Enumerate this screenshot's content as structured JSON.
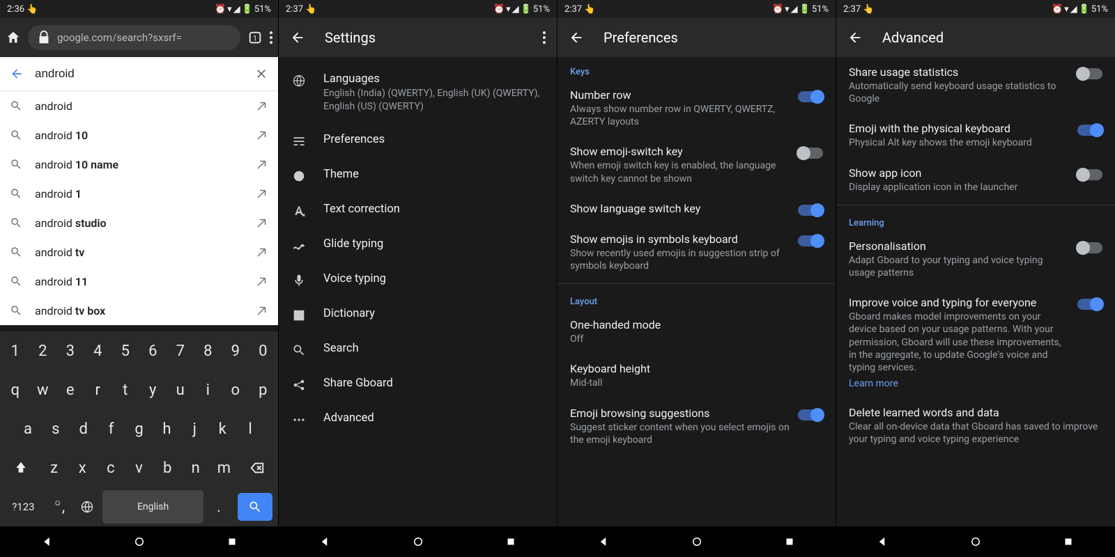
{
  "status": {
    "time1": "2:36",
    "time2": "2:37",
    "battery": "51%"
  },
  "panel1": {
    "url": "google.com/search?sxsrf=",
    "query": "android",
    "suggestions": [
      {
        "pre": "android",
        "bold": ""
      },
      {
        "pre": "android ",
        "bold": "10"
      },
      {
        "pre": "android ",
        "bold": "10 name"
      },
      {
        "pre": "android ",
        "bold": "1"
      },
      {
        "pre": "android ",
        "bold": "studio"
      },
      {
        "pre": "android ",
        "bold": "tv"
      },
      {
        "pre": "android ",
        "bold": "11"
      },
      {
        "pre": "android ",
        "bold": "tv box"
      }
    ],
    "kbd": {
      "row1": [
        "1",
        "2",
        "3",
        "4",
        "5",
        "6",
        "7",
        "8",
        "9",
        "0"
      ],
      "row2": [
        "q",
        "w",
        "e",
        "r",
        "t",
        "y",
        "u",
        "i",
        "o",
        "p"
      ],
      "row3": [
        "a",
        "s",
        "d",
        "f",
        "g",
        "h",
        "j",
        "k",
        "l"
      ],
      "row4": [
        "z",
        "x",
        "c",
        "v",
        "b",
        "n",
        "m"
      ],
      "sym": "?123",
      "lang": "English"
    }
  },
  "panel2": {
    "title": "Settings",
    "items": [
      {
        "title": "Languages",
        "sub": "English (India) (QWERTY), English (UK) (QWERTY), English (US) (QWERTY)"
      },
      {
        "title": "Preferences"
      },
      {
        "title": "Theme"
      },
      {
        "title": "Text correction"
      },
      {
        "title": "Glide typing"
      },
      {
        "title": "Voice typing"
      },
      {
        "title": "Dictionary"
      },
      {
        "title": "Search"
      },
      {
        "title": "Share Gboard"
      },
      {
        "title": "Advanced"
      }
    ]
  },
  "panel3": {
    "title": "Preferences",
    "sect1": "Keys",
    "items1": [
      {
        "title": "Number row",
        "sub": "Always show number row in QWERTY, QWERTZ, AZERTY layouts",
        "on": true
      },
      {
        "title": "Show emoji-switch key",
        "sub": "When emoji switch key is enabled, the language switch key cannot be shown",
        "on": false
      },
      {
        "title": "Show language switch key",
        "on": true
      },
      {
        "title": "Show emojis in symbols keyboard",
        "sub": "Show recently used emojis in suggestion strip of symbols keyboard",
        "on": true
      }
    ],
    "sect2": "Layout",
    "items2": [
      {
        "title": "One-handed mode",
        "sub": "Off"
      },
      {
        "title": "Keyboard height",
        "sub": "Mid-tall"
      },
      {
        "title": "Emoji browsing suggestions",
        "sub": "Suggest sticker content when you select emojis on the emoji keyboard",
        "on": true
      }
    ]
  },
  "panel4": {
    "title": "Advanced",
    "items1": [
      {
        "title": "Share usage statistics",
        "sub": "Automatically send keyboard usage statistics to Google",
        "on": false
      },
      {
        "title": "Emoji with the physical keyboard",
        "sub": "Physical Alt key shows the emoji keyboard",
        "on": true
      },
      {
        "title": "Show app icon",
        "sub": "Display application icon in the launcher",
        "on": false
      }
    ],
    "sect": "Learning",
    "items2": [
      {
        "title": "Personalisation",
        "sub": "Adapt Gboard to your typing and voice typing usage patterns",
        "on": false
      },
      {
        "title": "Improve voice and typing for everyone",
        "sub": "Gboard makes model improvements on your device based on your usage patterns. With your permission, Gboard will use these improvements, in the aggregate, to update Google's voice and typing services.",
        "on": true,
        "link": "Learn more"
      },
      {
        "title": "Delete learned words and data",
        "sub": "Clear all on-device data that Gboard has saved to improve your typing and voice typing experience"
      }
    ]
  }
}
